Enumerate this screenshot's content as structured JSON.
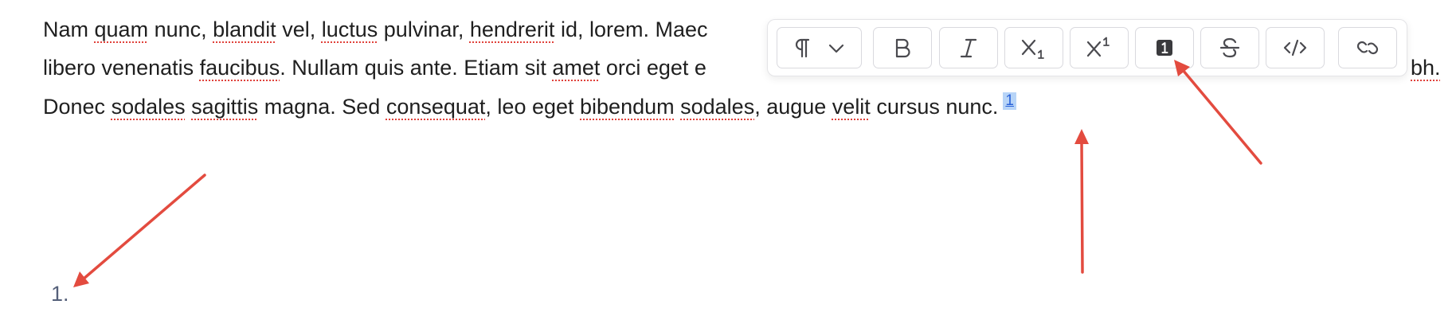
{
  "editor": {
    "line1": {
      "seg1": "Nam ",
      "w_quam": "quam",
      "seg2": " nunc, ",
      "w_blandit": "blandit",
      "seg3": " vel, ",
      "w_luctus": "luctus",
      "seg4": " pulvinar, ",
      "w_hendrerit": "hendrerit",
      "seg5": " id, lorem. Maec"
    },
    "line2": {
      "seg1": "libero venenatis ",
      "w_faucibus": "faucibus",
      "seg2": ". Nullam quis ante. Etiam sit ",
      "w_amet": "amet",
      "seg3": " orci eget e"
    },
    "line2_tail": "bh.",
    "line3": {
      "seg1": "Donec ",
      "w_sodales": "sodales",
      "seg2": " ",
      "w_sagittis": "sagittis",
      "seg3": " magna. Sed ",
      "w_consequat": "consequat",
      "seg4": ", leo eget ",
      "w_bibendum": "bibendum",
      "seg5": " ",
      "w_sodales2": "sodales",
      "seg6": ", augue ",
      "w_velit": "velit",
      "seg7": " cursus nunc."
    },
    "footnote_ref": "1",
    "footnote_list_marker": "1."
  },
  "toolbar": {
    "buttons": [
      {
        "name": "paragraph-format",
        "icon": "pilcrow-icon",
        "has_dropdown": true
      },
      {
        "name": "bold",
        "icon": "bold-icon"
      },
      {
        "name": "italic",
        "icon": "italic-icon"
      },
      {
        "name": "subscript",
        "icon": "subscript-icon"
      },
      {
        "name": "superscript",
        "icon": "superscript-icon"
      },
      {
        "name": "footnote",
        "icon": "footnote-icon"
      },
      {
        "name": "strikethrough",
        "icon": "strikethrough-icon"
      },
      {
        "name": "code",
        "icon": "code-icon"
      },
      {
        "name": "link",
        "icon": "link-icon"
      }
    ]
  },
  "colors": {
    "text": "#1f1f1f",
    "spell_underline": "#e0413a",
    "selection": "#b7d4f7",
    "footnote_link": "#2b63d9",
    "annotation_arrow": "#e34b3f"
  }
}
